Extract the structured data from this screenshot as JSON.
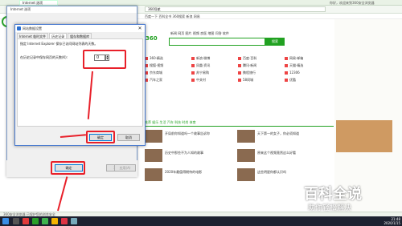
{
  "browser": {
    "tab_title": "Internet 选项",
    "address": "360导航",
    "top_right": "你好，欢迎来到360安全浏览器",
    "bookmarks": "百度一下  百科全书  360搜索  新浪  网易",
    "status": "360安全浏览器 已保护您的浏览安全"
  },
  "search": {
    "logo": "360",
    "tabs": "新闻  网页  图片  视频  良医  地图  问答  软件",
    "button": "搜索"
  },
  "sites": [
    "360·精选",
    "新浪·微博",
    "百度·百科",
    "网易·邮箱",
    "搜狐·视频",
    "凤凰·资讯",
    "腾讯·新闻",
    "天猫·精选",
    "京东商城",
    "苏宁易购",
    "携程旅行",
    "12306",
    "汽车之家",
    "中关村",
    "58同城",
    "优酷"
  ],
  "news_tabs": "推荐  娱乐  生活  汽车  科技  时尚  体育",
  "news": [
    "开局前你知道吗一个故事告诉你",
    "天下第一的女子，你必须知道",
    "历史中那些不为人知的故事",
    "原来这个视频竟然这么好看",
    "2020年最值得期待的电影",
    "这些明星你都认识吗"
  ],
  "watermark": {
    "logo": "百科全说",
    "subtitle": "助你轻松解决"
  },
  "internet_options_dialog": {
    "title": "Internet 选项",
    "ok": "确定",
    "cancel": "取消",
    "apply": "应用(A)"
  },
  "website_data_dialog": {
    "title": "网站数据设置",
    "close": "✕",
    "tabs": [
      "Internet 临时文件",
      "历史记录",
      "缓存和数据库"
    ],
    "description": "指定 Internet Explorer 保存已访问网站列表的天数。",
    "days_label": "在历史记录中保存网页的天数(K):",
    "days_value": "0",
    "ok": "确定",
    "cancel": "取消"
  },
  "clock": {
    "time": "21:48",
    "date": "2020/1/15"
  },
  "colors": {
    "annotation": "#e8202a",
    "brand_green": "#21a121",
    "taskbar": "#1d2130"
  }
}
